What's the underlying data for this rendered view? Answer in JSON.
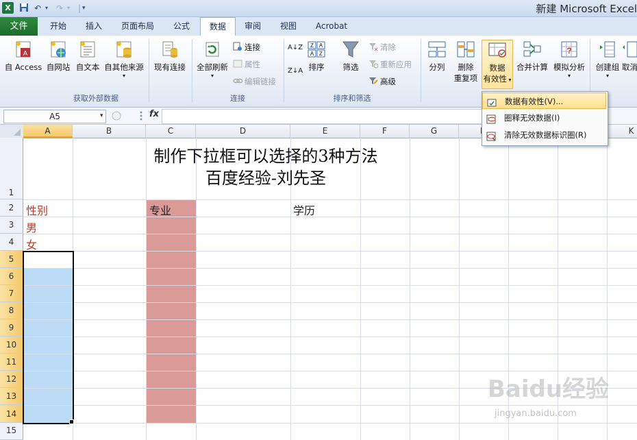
{
  "window": {
    "title": "新建 Microsoft Excel"
  },
  "qat": {
    "excel_icon": "X",
    "save_icon": "save-icon",
    "undo_icon": "undo-icon",
    "redo_icon": "redo-icon"
  },
  "tabs": [
    {
      "label": "文件"
    },
    {
      "label": "开始"
    },
    {
      "label": "插入"
    },
    {
      "label": "页面布局"
    },
    {
      "label": "公式"
    },
    {
      "label": "数据"
    },
    {
      "label": "审阅"
    },
    {
      "label": "视图"
    },
    {
      "label": "Acrobat"
    }
  ],
  "ribbon": {
    "get_external": {
      "label": "获取外部数据",
      "from_access": "自 Access",
      "from_web": "自网站",
      "from_text": "自文本",
      "from_other": "自其他来源"
    },
    "existing_connections": "现有连接",
    "connections": {
      "label": "连接",
      "refresh_all": "全部刷新",
      "connections": "连接",
      "properties": "属性",
      "edit_links": "编辑链接"
    },
    "sort_filter": {
      "label": "排序和筛选",
      "sort_az": "A↓Z",
      "sort_za": "Z↓A",
      "sort": "排序",
      "filter": "筛选",
      "clear": "清除",
      "reapply": "重新应用",
      "advanced": "高级"
    },
    "data_tools": {
      "text_to_columns": "分列",
      "remove_dup_1": "删除",
      "remove_dup_2": "重复项",
      "validation_1": "数据",
      "validation_2": "有效性",
      "consolidate": "合并计算",
      "what_if": "模拟分析"
    },
    "outline": {
      "group": "创建组",
      "ungroup": "取消"
    }
  },
  "formula_bar": {
    "name_box": "A5",
    "fx": "fx",
    "value": ""
  },
  "columns": [
    "A",
    "B",
    "C",
    "D",
    "E",
    "F",
    "G",
    "H",
    "I",
    "J",
    "K"
  ],
  "rows": [
    "1",
    "2",
    "3",
    "4",
    "5",
    "6",
    "7",
    "8",
    "9",
    "10",
    "11",
    "12",
    "13",
    "14",
    "15"
  ],
  "cells": {
    "title_line1": "制作下拉框可以选择的3种方法",
    "title_line2": "百度经验-刘先圣",
    "A2": "性别",
    "A3": "男",
    "A4": "女",
    "C2": "专业",
    "E2": "学历"
  },
  "menu": {
    "items": [
      {
        "label": "数据有效性(V)...",
        "icon": "validation-icon"
      },
      {
        "label": "圈释无效数据(I)",
        "icon": "circle-invalid-icon"
      },
      {
        "label": "清除无效数据标识圈(R)",
        "icon": "clear-circles-icon"
      }
    ]
  },
  "watermark": {
    "text": "Baidu经验",
    "url": "jingyan.baidu.com"
  },
  "colors": {
    "accent_green": "#1d6b2c",
    "selection_blue": "#bbdaf5",
    "column_c_red": "#da9a98",
    "text_red": "#c0392b"
  }
}
